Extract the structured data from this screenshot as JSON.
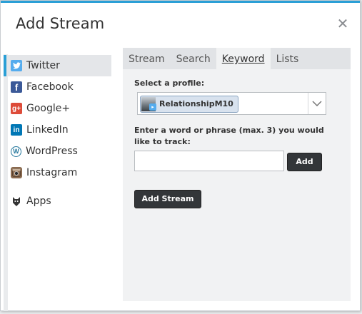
{
  "dialog": {
    "title": "Add Stream",
    "close_icon": "close-icon",
    "accent_color": "#2a9fd6"
  },
  "sidebar": {
    "items": [
      {
        "label": "Twitter",
        "icon": "twitter-icon",
        "active": true
      },
      {
        "label": "Facebook",
        "icon": "facebook-icon"
      },
      {
        "label": "Google+",
        "icon": "google-plus-icon"
      },
      {
        "label": "LinkedIn",
        "icon": "linkedin-icon"
      },
      {
        "label": "WordPress",
        "icon": "wordpress-icon"
      },
      {
        "label": "Instagram",
        "icon": "instagram-icon"
      },
      {
        "label": "Apps",
        "icon": "apps-icon"
      }
    ]
  },
  "tabs": [
    {
      "label": "Stream"
    },
    {
      "label": "Search"
    },
    {
      "label": "Keyword",
      "active": true
    },
    {
      "label": "Lists"
    }
  ],
  "form": {
    "profile_label": "Select a profile:",
    "profile_selected": "RelationshipM10",
    "keyword_label": "Enter a word or phrase (max. 3) you would like to track:",
    "keyword_value": "",
    "keyword_placeholder": "",
    "add_label": "Add",
    "add_stream_label": "Add Stream"
  }
}
